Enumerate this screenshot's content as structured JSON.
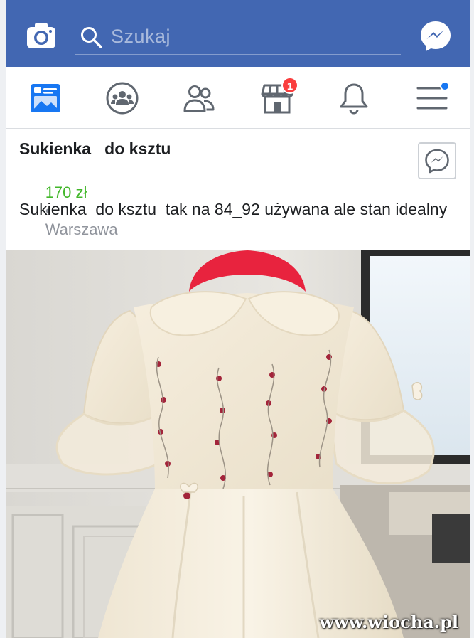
{
  "search": {
    "placeholder": "Szukaj"
  },
  "nav": {
    "items": [
      {
        "name": "news-feed",
        "icon": "news-feed-icon",
        "active": true
      },
      {
        "name": "groups",
        "icon": "groups-icon"
      },
      {
        "name": "friends",
        "icon": "friends-icon"
      },
      {
        "name": "marketplace",
        "icon": "marketplace-icon",
        "badge": "1"
      },
      {
        "name": "notifications",
        "icon": "bell-icon"
      },
      {
        "name": "menu",
        "icon": "hamburger-menu-icon",
        "dot": true
      }
    ]
  },
  "listing": {
    "title": "Sukienka   do ksztu",
    "price": "170 zł",
    "separator": "•",
    "location": "Warszawa",
    "description": "Sukienka  do ksztu  tak na 84_92 używana ale stan idealny"
  },
  "watermark": "www.wiocha.pl",
  "colors": {
    "brand_blue": "#4267b2",
    "price_green": "#42b72a",
    "badge_red": "#fa3e3e",
    "dot_blue": "#1877f2"
  }
}
